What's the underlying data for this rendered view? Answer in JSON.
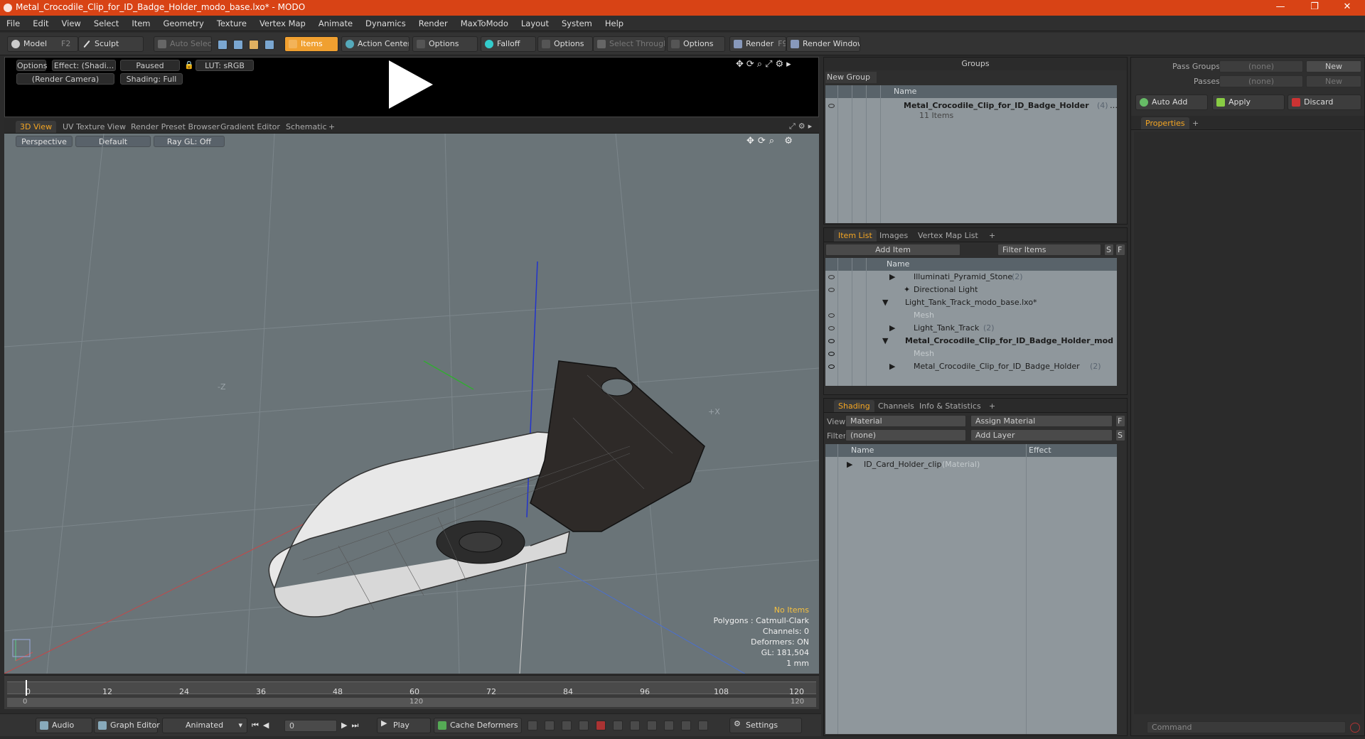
{
  "window": {
    "title": "Metal_Crocodile_Clip_for_ID_Badge_Holder_modo_base.lxo* - MODO",
    "controls": [
      "—",
      "❐",
      "✕"
    ]
  },
  "menu": [
    "File",
    "Edit",
    "View",
    "Select",
    "Item",
    "Geometry",
    "Texture",
    "Vertex Map",
    "Animate",
    "Dynamics",
    "Render",
    "MaxToModo",
    "Layout",
    "System",
    "Help"
  ],
  "toolbar": {
    "model": "Model",
    "model_key": "F2",
    "sculpt": "Sculpt",
    "auto_select": "Auto Select",
    "items": "Items",
    "action_center": "Action Center",
    "options1": "Options",
    "falloff": "Falloff",
    "options2": "Options",
    "select_through": "Select Through",
    "options3": "Options",
    "render": "Render",
    "render_key": "F9",
    "render_window": "Render Window"
  },
  "preview": {
    "options": "Options",
    "effect": "Effect: (Shadi...",
    "paused": "Paused",
    "lut": "LUT: sRGB",
    "camera": "(Render Camera)",
    "shading": "Shading: Full"
  },
  "viewtabs": [
    "3D View",
    "UV Texture View",
    "Render Preset Browser",
    "Gradient Editor",
    "Schematic",
    "+"
  ],
  "viewport": {
    "perspective": "Perspective",
    "default": "Default",
    "raygl": "Ray GL: Off",
    "axis_z": "-Z",
    "axis_x": "+X",
    "info": {
      "no_items": "No Items",
      "polygons": "Polygons : Catmull-Clark",
      "channels": "Channels: 0",
      "deformers": "Deformers: ON",
      "gl": "GL: 181,504",
      "unit": "1 mm"
    }
  },
  "timeline": {
    "ticks": [
      "0",
      "12",
      "24",
      "36",
      "48",
      "60",
      "72",
      "84",
      "96",
      "108",
      "120"
    ],
    "start": "0",
    "mid": "120",
    "end": "120"
  },
  "bottombar": {
    "audio": "Audio",
    "graph_editor": "Graph Editor",
    "animated": "Animated",
    "frame": "0",
    "play": "Play",
    "cache": "Cache Deformers",
    "settings": "Settings"
  },
  "groups": {
    "title": "Groups",
    "new_group": "New Group",
    "col_name": "Name",
    "item_name": "Metal_Crocodile_Clip_for_ID_Badge_Holder",
    "item_count": "(4)",
    "item_more": "…",
    "item_sub": "11 Items"
  },
  "itemlist": {
    "tabs": [
      "Item List",
      "Images",
      "Vertex Map List",
      "+"
    ],
    "add_item": "Add Item",
    "filter": "Filter Items",
    "s": "S",
    "f": "F",
    "col_name": "Name",
    "rows": [
      {
        "name": "Illuminati_Pyramid_Stone",
        "count": "(2)"
      },
      {
        "name": "Directional Light",
        "count": ""
      },
      {
        "name": "Light_Tank_Track_modo_base.lxo*",
        "count": ""
      },
      {
        "name": "Mesh",
        "count": ""
      },
      {
        "name": "Light_Tank_Track",
        "count": "(2)"
      },
      {
        "name": "Metal_Crocodile_Clip_for_ID_Badge_Holder_mod ...",
        "count": ""
      },
      {
        "name": "Mesh",
        "count": ""
      },
      {
        "name": "Metal_Crocodile_Clip_for_ID_Badge_Holder",
        "count": "(2)"
      }
    ]
  },
  "shading": {
    "tabs": [
      "Shading",
      "Channels",
      "Info & Statistics",
      "+"
    ],
    "view_label": "View",
    "view_value": "Material",
    "assign": "Assign Material",
    "f": "F",
    "filter_label": "Filter",
    "filter_value": "(none)",
    "add_layer": "Add Layer",
    "s": "S",
    "col_name": "Name",
    "col_effect": "Effect",
    "row_name": "ID_Card_Holder_clip",
    "row_type": "(Material)"
  },
  "right": {
    "pass_groups": "Pass Groups",
    "pass_groups_value": "(none)",
    "passes": "Passes",
    "passes_value": "(none)",
    "new1": "New",
    "new2": "New",
    "auto_add": "Auto Add",
    "apply": "Apply",
    "discard": "Discard",
    "properties": "Properties",
    "plus": "+",
    "command": "Command"
  },
  "colors": {
    "accent": "#f5a623",
    "title": "#d84315",
    "viewport": "#6a7478"
  }
}
